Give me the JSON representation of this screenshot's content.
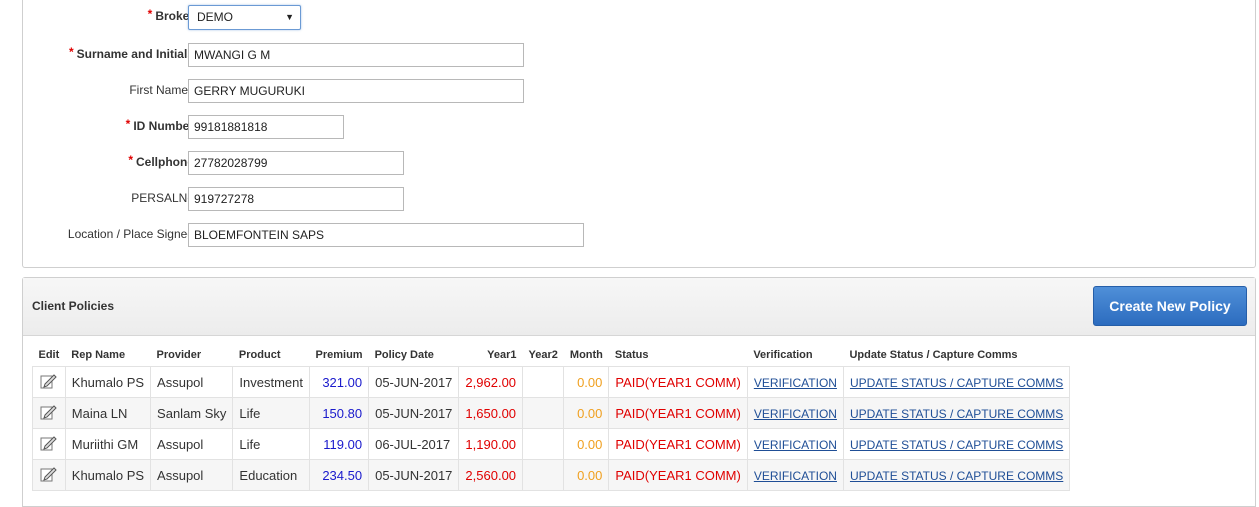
{
  "form": {
    "broker": {
      "label": "Broker",
      "value": "DEMO"
    },
    "surname": {
      "label": "Surname and Initials",
      "value": "MWANGI G M"
    },
    "first_names": {
      "label": "First Names",
      "value": "GERRY MUGURUKI"
    },
    "id_number": {
      "label": "ID Number",
      "value": "99181881818"
    },
    "cellphone": {
      "label": "Cellphone",
      "value": "27782028799"
    },
    "persal": {
      "label": "PERSALNo",
      "value": "919727278"
    },
    "location": {
      "label": "Location / Place Signed",
      "value": "BLOEMFONTEIN SAPS"
    },
    "required_marker": "*"
  },
  "policies": {
    "title": "Client Policies",
    "create_button": "Create New Policy",
    "columns": [
      "Edit",
      "Rep Name",
      "Provider",
      "Product",
      "Premium",
      "Policy Date",
      "Year1",
      "Year2",
      "Month",
      "Status",
      "Verification",
      "Update Status / Capture Comms"
    ],
    "rows": [
      {
        "rep": "Khumalo PS",
        "provider": "Assupol",
        "product": "Investment",
        "premium": "321.00",
        "date": "05-JUN-2017",
        "year1": "2,962.00",
        "year2": "",
        "month": "0.00",
        "status": "PAID(YEAR1 COMM)",
        "verification": "VERIFICATION",
        "update": "UPDATE STATUS / CAPTURE COMMS"
      },
      {
        "rep": "Maina LN",
        "provider": "Sanlam Sky",
        "product": "Life",
        "premium": "150.80",
        "date": "05-JUN-2017",
        "year1": "1,650.00",
        "year2": "",
        "month": "0.00",
        "status": "PAID(YEAR1 COMM)",
        "verification": "VERIFICATION",
        "update": "UPDATE STATUS / CAPTURE COMMS"
      },
      {
        "rep": "Muriithi GM",
        "provider": "Assupol",
        "product": "Life",
        "premium": "119.00",
        "date": "06-JUL-2017",
        "year1": "1,190.00",
        "year2": "",
        "month": "0.00",
        "status": "PAID(YEAR1 COMM)",
        "verification": "VERIFICATION",
        "update": "UPDATE STATUS / CAPTURE COMMS"
      },
      {
        "rep": "Khumalo PS",
        "provider": "Assupol",
        "product": "Education",
        "premium": "234.50",
        "date": "05-JUN-2017",
        "year1": "2,560.00",
        "year2": "",
        "month": "0.00",
        "status": "PAID(YEAR1 COMM)",
        "verification": "VERIFICATION",
        "update": "UPDATE STATUS / CAPTURE COMMS"
      }
    ]
  },
  "colors": {
    "required": "#e00000",
    "premium": "#1a1acc",
    "year1": "#e00000",
    "month": "#f0a020",
    "status": "#e00000",
    "link": "#1f4e96",
    "button": "#3a7bd0"
  },
  "icons": {
    "edit": "edit-pencil-icon",
    "dropdown": "chevron-down-icon"
  }
}
